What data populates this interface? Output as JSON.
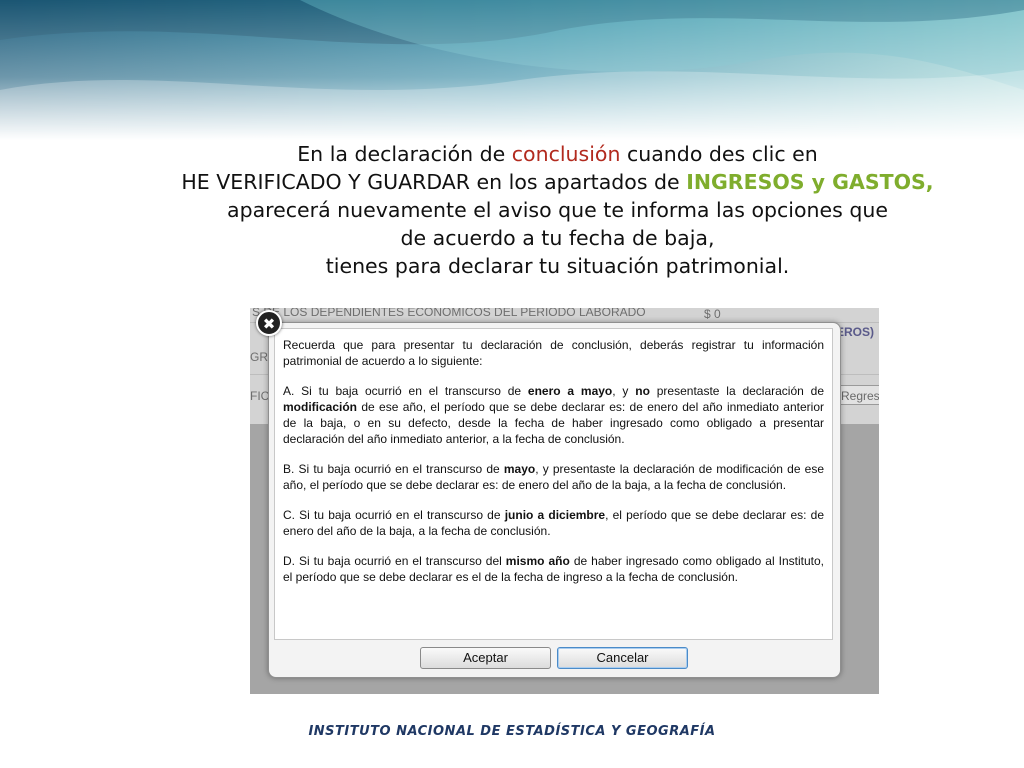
{
  "intro": {
    "line1_pre": "En la declaración de ",
    "line1_hl": "conclusión",
    "line1_post": " cuando des clic en",
    "line2_pre": "HE VERIFICADO Y GUARDAR en los apartados de ",
    "line2_hl": "INGRESOS y GASTOS,",
    "line3": "aparecerá nuevamente el aviso que te informa las opciones que",
    "line4": "de acuerdo a tu fecha de baja,",
    "line5": "tienes para declarar tu situación patrimonial."
  },
  "background_form": {
    "row1": "S DE LOS DEPENDIENTES ECONÓMICOS DEL PERIODO LABORADO",
    "row1_amount": "$  0",
    "row2_right": "EROS)",
    "row2_left": "GR",
    "row3_left": "FIC/",
    "regresar_label": "Regres"
  },
  "dialog": {
    "close_symbol": "✖",
    "intro": "Recuerda que para presentar tu declaración de conclusión, deberás registrar tu información patrimonial de acuerdo a lo siguiente:",
    "a_pre": "A. Si tu baja ocurrió en el transcurso de ",
    "a_bold1": "enero a mayo",
    "a_mid1": ", y ",
    "a_bold2": "no",
    "a_mid2": " presentaste la declaración de ",
    "a_bold3": "modificación",
    "a_post": " de ese año, el período que se debe declarar es: de enero del año inmediato anterior de la baja, o en su defecto, desde la fecha de haber ingresado como obligado a presentar declaración del año inmediato anterior, a la fecha de conclusión.",
    "b_pre": "B. Si tu baja ocurrió en el transcurso de ",
    "b_bold": "mayo",
    "b_post": ", y presentaste la declaración de modificación de ese año, el período que se debe declarar es: de enero del año de la baja, a la fecha de conclusión.",
    "c_pre": "C. Si tu baja ocurrió en el transcurso de ",
    "c_bold": "junio a diciembre",
    "c_post": ", el período que se debe declarar es: de enero del año de la baja, a la fecha de conclusión.",
    "d_pre": "D. Si tu baja ocurrió en el transcurso del ",
    "d_bold": "mismo año",
    "d_post": " de haber ingresado como obligado al Instituto, el período que se debe declarar es el de la fecha de ingreso a la fecha de conclusión.",
    "accept_label": "Aceptar",
    "cancel_label": "Cancelar"
  },
  "footer": {
    "institute": "INSTITUTO NACIONAL  DE ESTADÍSTICA Y GEOGRAFÍA"
  },
  "colors": {
    "highlight_red": "#b22a1e",
    "highlight_green": "#7fad2d",
    "footer_blue": "#1f3864",
    "banner_teal": "#2f7f9a"
  }
}
